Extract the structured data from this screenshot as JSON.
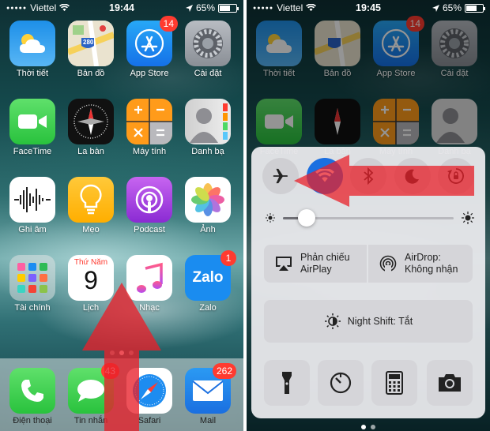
{
  "left": {
    "status": {
      "carrier": "Viettel",
      "time": "19:44",
      "battery_text": "65%",
      "battery_level": 0.65
    },
    "apps": [
      {
        "name": "weather-app",
        "label": "Thời tiết",
        "icon": "cloud-sun-icon"
      },
      {
        "name": "maps-app",
        "label": "Bản đồ",
        "icon": "map-icon",
        "sign": "280"
      },
      {
        "name": "app-store-app",
        "label": "App Store",
        "icon": "app-store-icon",
        "badge": "14"
      },
      {
        "name": "settings-app",
        "label": "Cài đặt",
        "icon": "gear-icon"
      },
      {
        "name": "facetime-app",
        "label": "FaceTime",
        "icon": "video-camera-icon"
      },
      {
        "name": "compass-app",
        "label": "La bàn",
        "icon": "compass-icon"
      },
      {
        "name": "calculator-app",
        "label": "Máy tính",
        "icon": "calculator-icon"
      },
      {
        "name": "contacts-app",
        "label": "Danh bạ",
        "icon": "contacts-icon"
      },
      {
        "name": "voice-memos-app",
        "label": "Ghi âm",
        "icon": "waveform-icon"
      },
      {
        "name": "tips-app",
        "label": "Mẹo",
        "icon": "lightbulb-icon"
      },
      {
        "name": "podcast-app",
        "label": "Podcast",
        "icon": "podcast-icon"
      },
      {
        "name": "photos-app",
        "label": "Ảnh",
        "icon": "photos-flower-icon"
      },
      {
        "name": "finance-folder",
        "label": "Tài chính",
        "icon": "folder-icon"
      },
      {
        "name": "calendar-app",
        "label": "Lịch",
        "icon": "calendar-icon",
        "weekday": "Thứ Năm",
        "day": "9"
      },
      {
        "name": "music-app",
        "label": "Nhạc",
        "icon": "music-note-icon"
      },
      {
        "name": "zalo-app",
        "label": "Zalo",
        "icon": "zalo-logo-icon",
        "badge": "1",
        "logo_text": "Zalo"
      }
    ],
    "dock": [
      {
        "name": "phone-app",
        "label": "Điện thoại",
        "icon": "phone-icon"
      },
      {
        "name": "messages-app",
        "label": "Tin nhắn",
        "icon": "message-bubble-icon",
        "badge": "43"
      },
      {
        "name": "safari-app",
        "label": "Safari",
        "icon": "compass-safari-icon"
      },
      {
        "name": "mail-app",
        "label": "Mail",
        "icon": "envelope-icon",
        "badge": "262"
      }
    ],
    "arrow_color": "#e8202a"
  },
  "right": {
    "status": {
      "carrier": "Viettel",
      "time": "19:45",
      "battery_text": "65%",
      "battery_level": 0.65
    },
    "control_center": {
      "toggles": [
        {
          "name": "airplane-mode-toggle",
          "icon": "airplane-icon",
          "active": false
        },
        {
          "name": "wifi-toggle",
          "icon": "wifi-icon",
          "active": true
        },
        {
          "name": "bluetooth-toggle",
          "icon": "bluetooth-icon",
          "active": false
        },
        {
          "name": "do-not-disturb-toggle",
          "icon": "moon-icon",
          "active": false
        },
        {
          "name": "rotation-lock-toggle",
          "icon": "rotation-lock-icon",
          "active": false
        }
      ],
      "brightness_level": 0.14,
      "airplay": {
        "line1": "Phản chiếu",
        "line2": "AirPlay"
      },
      "airdrop": {
        "line1": "AirDrop:",
        "line2": "Không nhận"
      },
      "night_shift": "Night Shift: Tắt",
      "bottom_tiles": [
        {
          "name": "flashlight-button",
          "icon": "flashlight-icon"
        },
        {
          "name": "timer-button",
          "icon": "timer-icon"
        },
        {
          "name": "calculator-button",
          "icon": "calculator-icon"
        },
        {
          "name": "camera-button",
          "icon": "camera-icon"
        }
      ]
    },
    "arrow_color": "#e8202a"
  }
}
